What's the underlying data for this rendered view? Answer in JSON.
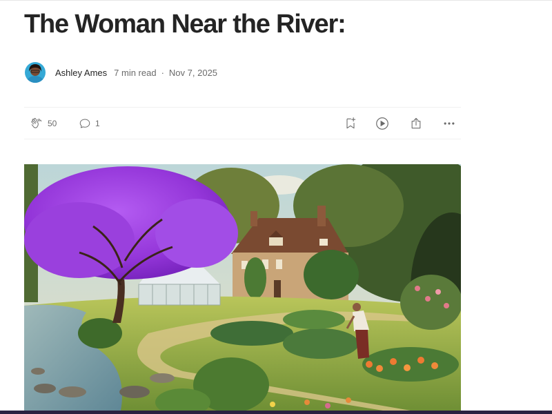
{
  "article": {
    "title": "The Woman Near the River:",
    "author": "Ashley Ames",
    "read_time": "7 min read",
    "separator": "·",
    "date": "Nov 7, 2025"
  },
  "actions": {
    "claps": "50",
    "responses": "1",
    "icons": [
      "clap-icon",
      "response-icon",
      "save-icon",
      "listen-icon",
      "share-icon",
      "more-icon"
    ]
  },
  "hero": {
    "description_icon": "image",
    "colors": {
      "tree": "#9b3fe0",
      "sky": "#cfe0dc",
      "grass": "#8fae4a",
      "water": "#7fa6b3"
    }
  }
}
